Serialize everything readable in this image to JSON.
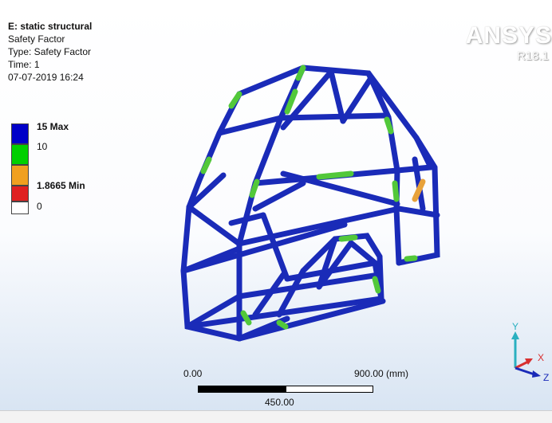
{
  "info": {
    "title": "E: static structural",
    "result": "Safety Factor",
    "type": "Type: Safety Factor",
    "time": "Time: 1",
    "datetime": "07-07-2019 16:24"
  },
  "legend": {
    "entries": [
      {
        "label": "15 Max",
        "color": "#0000c8"
      },
      {
        "label": "10",
        "color": "#00d000"
      },
      {
        "label": "1.8665 Min",
        "color": "#f0a020"
      },
      {
        "label": "0",
        "color": "#e02020"
      }
    ],
    "bottom_color": "#ffffff"
  },
  "logo": {
    "name": "ANSYS",
    "version": "R18.1"
  },
  "scale": {
    "left": "0.00",
    "right": "900.00 (mm)",
    "mid": "450.00"
  },
  "triad": {
    "y": "Y",
    "x": "X",
    "z": "Z"
  },
  "colors": {
    "frame": "#1a2bb8",
    "frame_dark": "#0a1480",
    "safe_low": "#52c83a",
    "warn": "#e8a23a"
  }
}
